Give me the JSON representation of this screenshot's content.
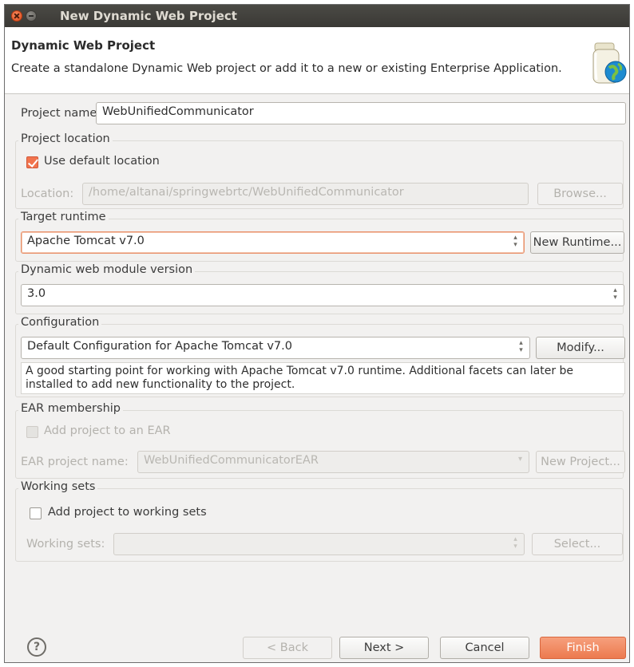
{
  "window": {
    "title": "New Dynamic Web Project"
  },
  "header": {
    "title": "Dynamic Web Project",
    "description": "Create a standalone Dynamic Web project or add it to a new or existing Enterprise Application."
  },
  "project_name": {
    "label": "Project name:",
    "value": "WebUnifiedCommunicator"
  },
  "project_location": {
    "group_label": "Project location",
    "use_default_label": "Use default location",
    "use_default_checked": true,
    "location_label": "Location:",
    "location_value": "/home/altanai/springwebrtc/WebUnifiedCommunicator",
    "browse_label": "Browse..."
  },
  "target_runtime": {
    "group_label": "Target runtime",
    "value": "Apache Tomcat v7.0",
    "new_runtime_label": "New Runtime..."
  },
  "module_version": {
    "group_label": "Dynamic web module version",
    "value": "3.0"
  },
  "configuration": {
    "group_label": "Configuration",
    "value": "Default Configuration for Apache Tomcat v7.0",
    "modify_label": "Modify...",
    "description": "A good starting point for working with Apache Tomcat v7.0 runtime. Additional facets can later be installed to add new functionality to the project."
  },
  "ear": {
    "group_label": "EAR membership",
    "add_label": "Add project to an EAR",
    "add_checked": false,
    "name_label": "EAR project name:",
    "name_value": "WebUnifiedCommunicatorEAR",
    "new_project_label": "New Project..."
  },
  "working_sets": {
    "group_label": "Working sets",
    "add_label": "Add project to working sets",
    "add_checked": false,
    "sets_label": "Working sets:",
    "sets_value": "",
    "select_label": "Select..."
  },
  "footer": {
    "help_glyph": "?",
    "back_label": "< Back",
    "next_label": "Next >",
    "cancel_label": "Cancel",
    "finish_label": "Finish"
  },
  "colors": {
    "accent": "#ec7a4f",
    "titlebar": "#3c3b37",
    "dialog_bg": "#f2f1f0"
  },
  "icons": [
    "close-icon",
    "minimize-icon",
    "web-project-icon",
    "help-icon",
    "spinner-icon"
  ]
}
